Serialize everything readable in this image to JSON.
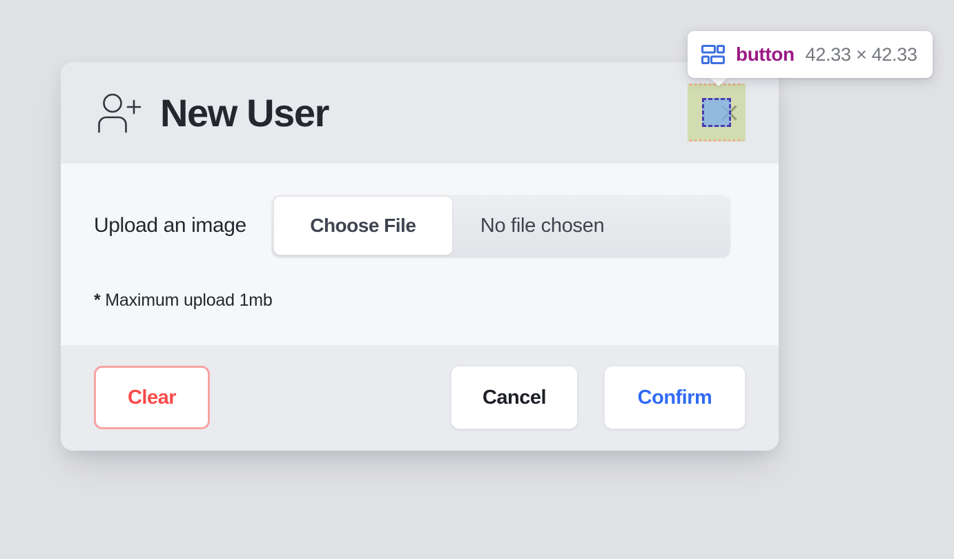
{
  "modal": {
    "header": {
      "icon": "user-plus-icon",
      "title": "New User",
      "close_icon": "close-x-icon"
    },
    "body": {
      "upload_label": "Upload an image",
      "choose_file_label": "Choose File",
      "file_status": "No file chosen",
      "hint_star": "*",
      "hint_text": "Maximum upload 1mb"
    },
    "footer": {
      "clear_label": "Clear",
      "cancel_label": "Cancel",
      "confirm_label": "Confirm"
    }
  },
  "inspector": {
    "icon": "layout-grid-icon",
    "tag": "button",
    "dimensions": "42.33 × 42.33",
    "highlight": {
      "box_color": "#c5d38a",
      "content_fill": "#82b1eb",
      "content_border": "#4b3cb0",
      "margin_stripe": "#f0a98c"
    }
  },
  "colors": {
    "page_background": "#e0e1e4",
    "card_header": "#e8e9ed",
    "card_body": "#f6f7f9",
    "card_footer": "#eaebef",
    "title_text": "#24272e",
    "clear_border": "#f9a3a0",
    "clear_text": "#fb4a4a",
    "confirm_text": "#316bf4",
    "tooltip_tag_text": "#9c1a85",
    "tooltip_dims_text": "#75797f",
    "tooltip_icon": "#3d6fe0"
  }
}
